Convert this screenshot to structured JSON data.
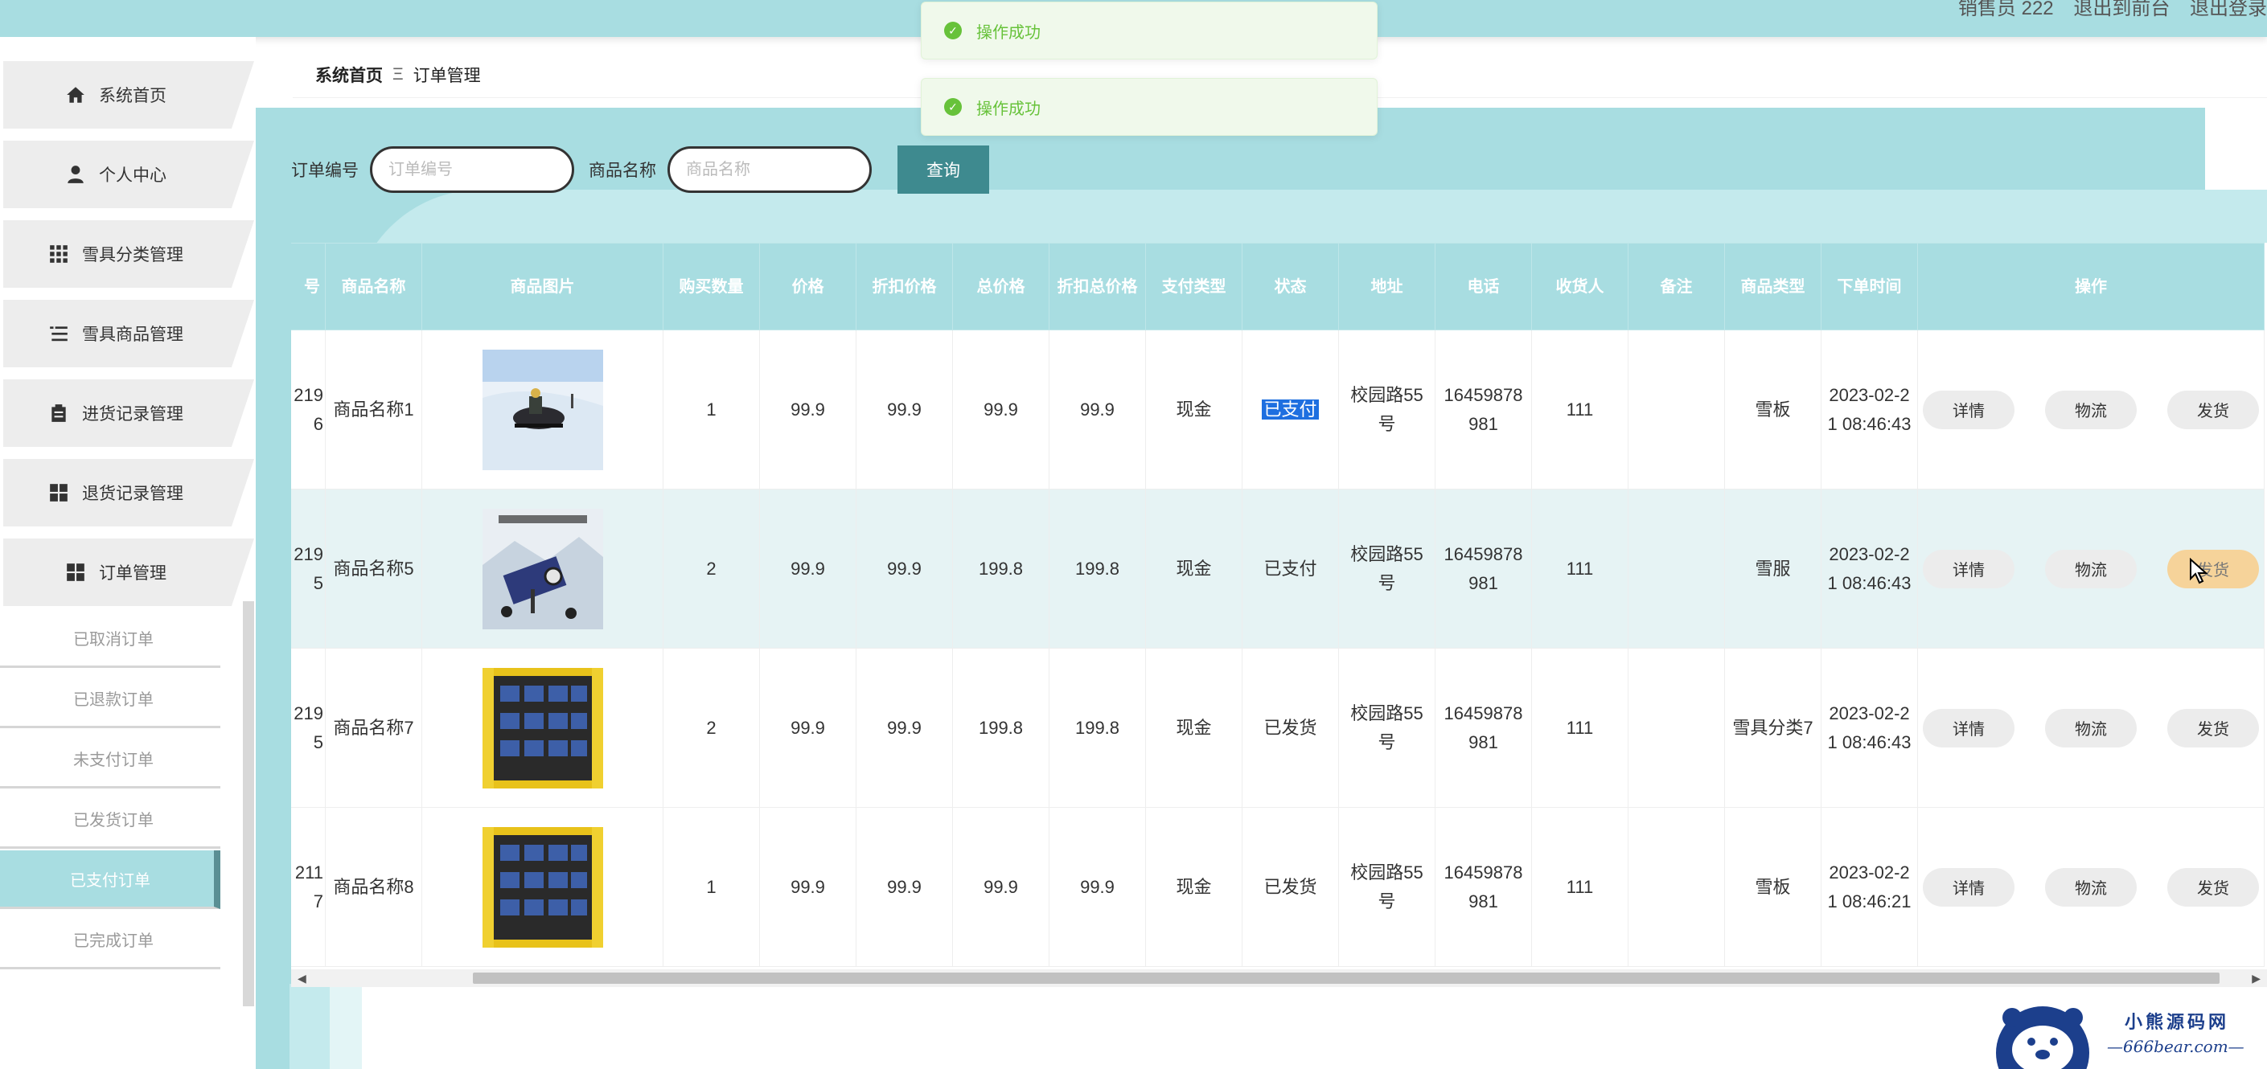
{
  "header": {
    "user_label": "销售员 222",
    "front_link": "退出到前台",
    "logout_link": "退出登录",
    "bg_color": "#a8dde1"
  },
  "sidebar": {
    "items": [
      {
        "label": "系统首页",
        "icon": "home-icon"
      },
      {
        "label": "个人中心",
        "icon": "user-icon"
      },
      {
        "label": "雪具分类管理",
        "icon": "grid-icon"
      },
      {
        "label": "雪具商品管理",
        "icon": "list-icon"
      },
      {
        "label": "进货记录管理",
        "icon": "clipboard-icon"
      },
      {
        "label": "退货记录管理",
        "icon": "grid-icon"
      },
      {
        "label": "订单管理",
        "icon": "grid-icon"
      }
    ],
    "sub_items": [
      {
        "label": "已取消订单"
      },
      {
        "label": "已退款订单"
      },
      {
        "label": "未支付订单"
      },
      {
        "label": "已发货订单"
      },
      {
        "label": "已支付订单",
        "active": true
      },
      {
        "label": "已完成订单"
      }
    ]
  },
  "breadcrumb": {
    "home": "系统首页",
    "separator": "Ξ",
    "current": "订单管理"
  },
  "toasts": [
    {
      "text": "操作成功"
    },
    {
      "text": "操作成功"
    }
  ],
  "search": {
    "order_no_label": "订单编号",
    "order_no_placeholder": "订单编号",
    "product_label": "商品名称",
    "product_placeholder": "商品名称",
    "query_button": "查询"
  },
  "table": {
    "headers": [
      "号",
      "商品名称",
      "商品图片",
      "购买数量",
      "价格",
      "折扣价格",
      "总价格",
      "折扣总价格",
      "支付类型",
      "状态",
      "地址",
      "电话",
      "收货人",
      "备注",
      "商品类型",
      "下单时间",
      "操作"
    ],
    "rows": [
      {
        "no": "2196",
        "name": "商品名称1",
        "image": "snowmobile-photo",
        "qty": "1",
        "price": "99.9",
        "discount_price": "99.9",
        "total": "99.9",
        "discount_total": "99.9",
        "pay_type": "现金",
        "status": "已支付",
        "address": "校园路55号",
        "phone": "16459878981",
        "receiver": "111",
        "note": "",
        "type": "雪板",
        "time": "2023-02-21 08:46:43"
      },
      {
        "no": "2195",
        "name": "商品名称5",
        "image": "snow-machine-photo",
        "qty": "2",
        "price": "99.9",
        "discount_price": "99.9",
        "total": "199.8",
        "discount_total": "199.8",
        "pay_type": "现金",
        "status": "已支付",
        "address": "校园路55号",
        "phone": "16459878981",
        "receiver": "111",
        "note": "",
        "type": "雪服",
        "time": "2023-02-21 08:46:43"
      },
      {
        "no": "2195",
        "name": "商品名称7",
        "image": "ski-boots-photo",
        "qty": "2",
        "price": "99.9",
        "discount_price": "99.9",
        "total": "199.8",
        "discount_total": "199.8",
        "pay_type": "现金",
        "status": "已发货",
        "address": "校园路55号",
        "phone": "16459878981",
        "receiver": "111",
        "note": "",
        "type": "雪具分类7",
        "time": "2023-02-21 08:46:43"
      },
      {
        "no": "2117",
        "name": "商品名称8",
        "image": "ski-boots-photo",
        "qty": "1",
        "price": "99.9",
        "discount_price": "99.9",
        "total": "99.9",
        "discount_total": "99.9",
        "pay_type": "现金",
        "status": "已发货",
        "address": "校园路55号",
        "phone": "16459878981",
        "receiver": "111",
        "note": "",
        "type": "雪板",
        "time": "2023-02-21 08:46:21"
      }
    ],
    "actions": {
      "detail": "详情",
      "logistics": "物流",
      "ship": "发货"
    }
  },
  "watermark": {
    "line1": "小熊源码网",
    "line2": "—666bear.com—"
  }
}
